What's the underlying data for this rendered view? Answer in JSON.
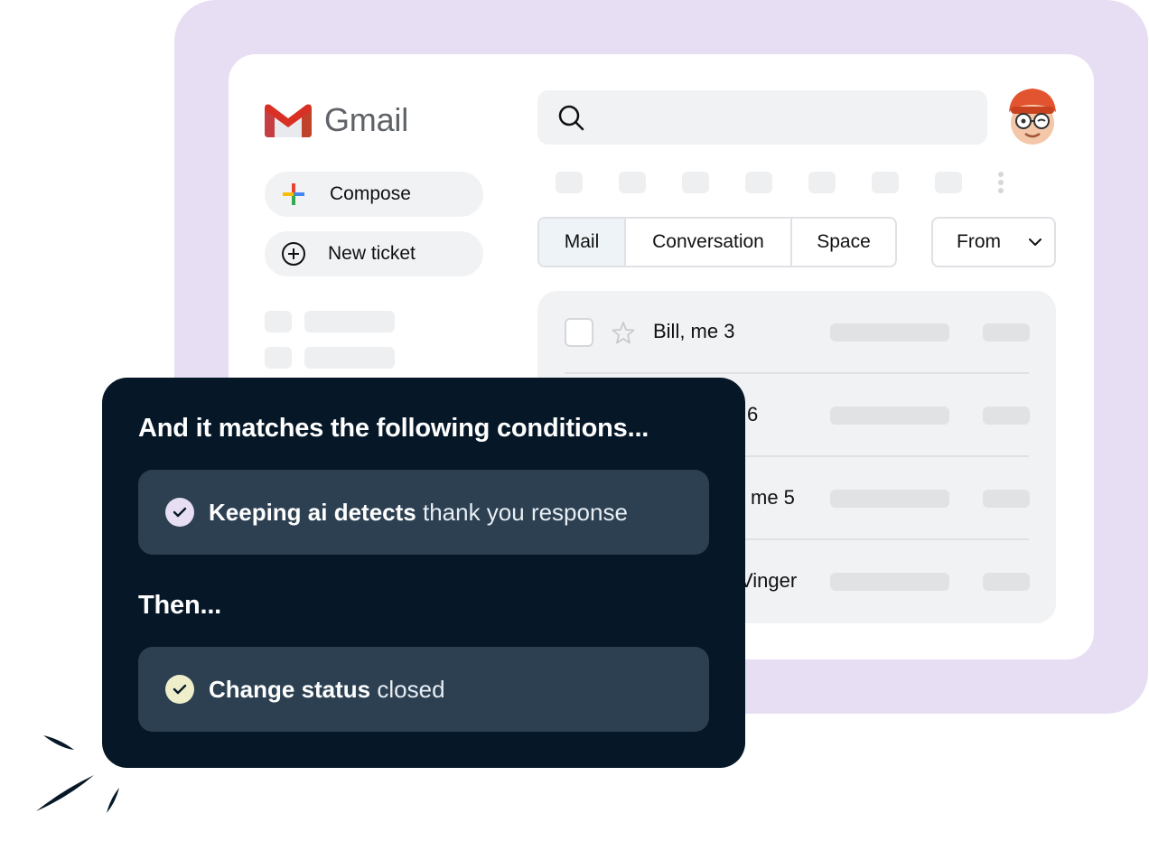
{
  "colors": {
    "lavender_bg": "#e7def3",
    "panel_dark": "#061828",
    "rule_box": "#2c4052",
    "check_condition": "#e7def3",
    "check_action": "#efeecb",
    "gmail_red": "#d93025"
  },
  "gmail": {
    "logo_text": "Gmail",
    "compose_label": "Compose",
    "new_ticket_label": "New ticket",
    "tabs": [
      {
        "label": "Mail",
        "active": true
      },
      {
        "label": "Conversation",
        "active": false
      },
      {
        "label": "Space",
        "active": false
      }
    ],
    "from_label": "From",
    "rows": [
      {
        "sender": "Bill, me 3"
      },
      {
        "sender": "6"
      },
      {
        "sender": "me 5"
      },
      {
        "sender": "Vinger"
      }
    ]
  },
  "rule": {
    "conditions_heading": "And it matches the following conditions...",
    "condition": {
      "strong": "Keeping ai detects",
      "value": "thank you response"
    },
    "then_heading": "Then...",
    "action": {
      "strong": "Change status",
      "value": "closed"
    }
  },
  "icons": [
    "gmail-logo-icon",
    "plus-icon",
    "circle-plus-icon",
    "search-icon",
    "avatar",
    "more-vertical-icon",
    "chevron-down-icon",
    "star-icon",
    "checkmark-icon"
  ]
}
